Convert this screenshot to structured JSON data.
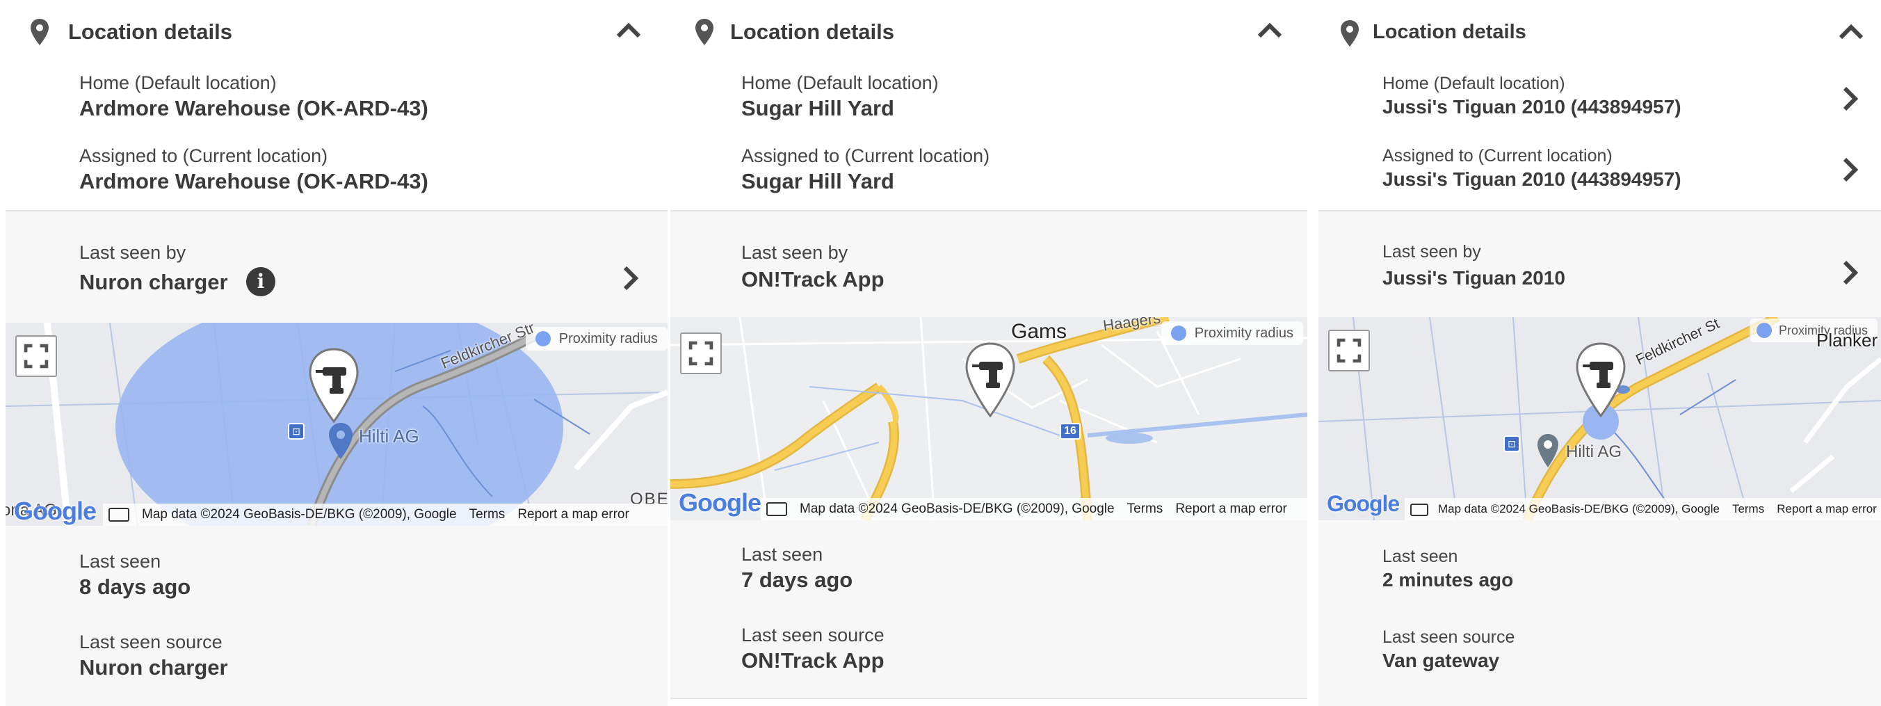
{
  "panels": [
    {
      "title": "Location details",
      "home_label": "Home (Default location)",
      "home_value": "Ardmore Warehouse (OK-ARD-43)",
      "assigned_label": "Assigned to (Current location)",
      "assigned_value": "Ardmore Warehouse (OK-ARD-43)",
      "last_seen_by_label": "Last seen by",
      "last_seen_by_value": "Nuron charger",
      "info_glyph": "i",
      "map": {
        "proximity_label": "Proximity radius",
        "place_label": "Hilti AG",
        "street_label": "Feldkircher Str",
        "edge_label_left": "ona AG",
        "edge_label_right": "OBE",
        "google": "Google",
        "attribution": "Map data ©2024 GeoBasis-DE/BKG (©2009), Google",
        "terms": "Terms",
        "report": "Report a map error"
      },
      "last_seen_label": "Last seen",
      "last_seen_value": "8 days ago",
      "source_label": "Last seen source",
      "source_value": "Nuron charger"
    },
    {
      "title": "Location details",
      "home_label": "Home (Default location)",
      "home_value": "Sugar Hill Yard",
      "assigned_label": "Assigned to (Current location)",
      "assigned_value": "Sugar Hill Yard",
      "last_seen_by_label": "Last seen by",
      "last_seen_by_value": "ON!Track App",
      "map": {
        "proximity_label": "Proximity radius",
        "town_label": "Gams",
        "road_label": "Haagers",
        "road_number": "16",
        "google": "Google",
        "attribution": "Map data ©2024 GeoBasis-DE/BKG (©2009), Google",
        "terms": "Terms",
        "report": "Report a map error"
      },
      "last_seen_label": "Last seen",
      "last_seen_value": "7 days ago",
      "source_label": "Last seen source",
      "source_value": "ON!Track App"
    },
    {
      "title": "Location details",
      "home_label": "Home (Default location)",
      "home_value": "Jussi's Tiguan 2010 (443894957)",
      "assigned_label": "Assigned to (Current location)",
      "assigned_value": "Jussi's Tiguan 2010 (443894957)",
      "last_seen_by_label": "Last seen by",
      "last_seen_by_value": "Jussi's Tiguan 2010",
      "map": {
        "proximity_label": "Proximity radius",
        "place_label": "Hilti AG",
        "street_label": "Feldkircher St",
        "edge_label_right": "Planker",
        "google": "Google",
        "attribution": "Map data ©2024 GeoBasis-DE/BKG (©2009), Google",
        "terms": "Terms",
        "report": "Report a map error"
      },
      "last_seen_label": "Last seen",
      "last_seen_value": "2 minutes ago",
      "source_label": "Last seen source",
      "source_value": "Van gateway"
    }
  ],
  "colors": {
    "proximity": "#7ba2f0",
    "road_yellow": "#f5c542",
    "text_dark": "#3a3a3a",
    "section_gray": "#f7f7f7"
  }
}
